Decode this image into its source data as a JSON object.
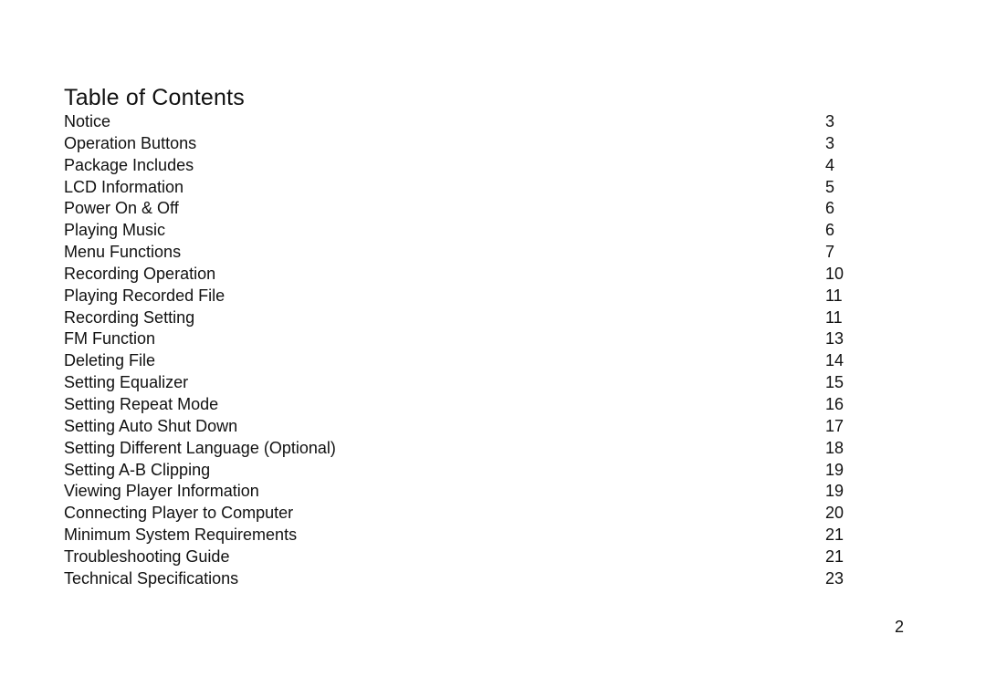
{
  "title": "Table of Contents",
  "entries": [
    {
      "label": "Notice",
      "page": "3"
    },
    {
      "label": "Operation Buttons",
      "page": "3"
    },
    {
      "label": "Package Includes",
      "page": "4"
    },
    {
      "label": "LCD Information",
      "page": "5"
    },
    {
      "label": "Power On & Off",
      "page": "6"
    },
    {
      "label": "Playing Music",
      "page": "6"
    },
    {
      "label": "Menu Functions",
      "page": "7"
    },
    {
      "label": "Recording Operation",
      "page": "10"
    },
    {
      "label": "Playing Recorded File",
      "page": "11"
    },
    {
      "label": "Recording Setting",
      "page": "11"
    },
    {
      "label": "FM Function",
      "page": "13"
    },
    {
      "label": "Deleting File",
      "page": "14"
    },
    {
      "label": "Setting Equalizer",
      "page": "15"
    },
    {
      "label": "Setting Repeat Mode",
      "page": "16"
    },
    {
      "label": "Setting Auto Shut Down",
      "page": "17"
    },
    {
      "label": "Setting Different Language (Optional)",
      "page": "18"
    },
    {
      "label": "Setting A-B Clipping",
      "page": "19"
    },
    {
      "label": "Viewing Player Information",
      "page": "19"
    },
    {
      "label": "Connecting Player to Computer",
      "page": "20"
    },
    {
      "label": "Minimum System Requirements",
      "page": "21"
    },
    {
      "label": "Troubleshooting Guide",
      "page": "21"
    },
    {
      "label": "Technical Specifications",
      "page": "23"
    }
  ],
  "page_number": "2"
}
